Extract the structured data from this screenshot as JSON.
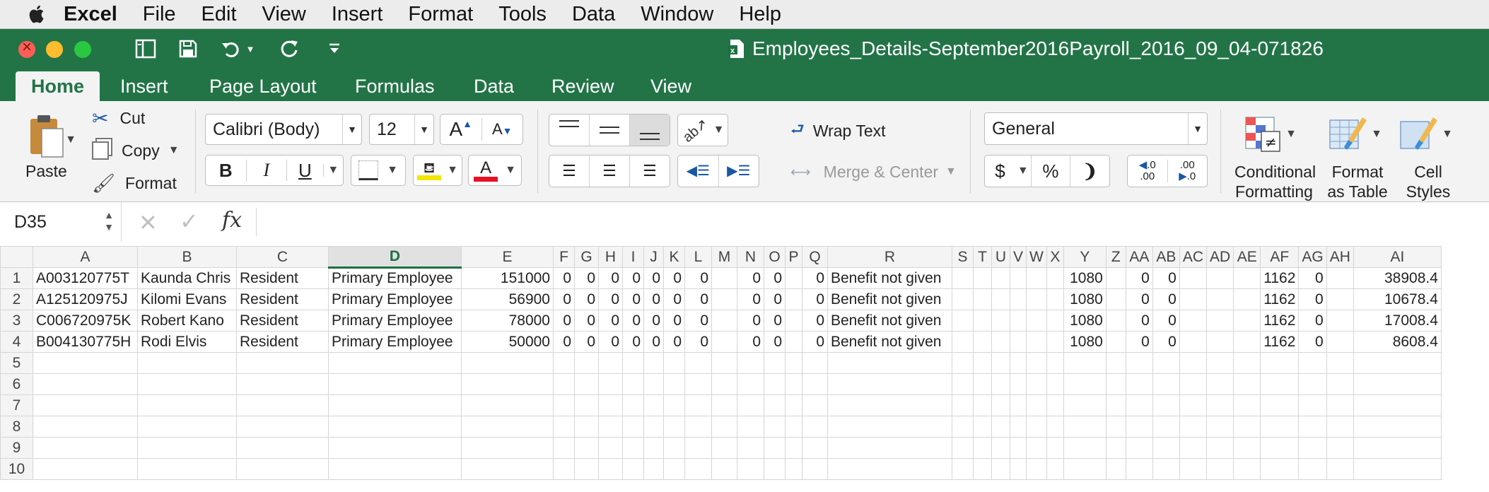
{
  "menubar": {
    "app": "Excel",
    "items": [
      "File",
      "Edit",
      "View",
      "Insert",
      "Format",
      "Tools",
      "Data",
      "Window",
      "Help"
    ]
  },
  "window": {
    "title": "Employees_Details-September2016Payroll_2016_09_04-071826"
  },
  "ribbon_tabs": [
    "Home",
    "Insert",
    "Page Layout",
    "Formulas",
    "Data",
    "Review",
    "View"
  ],
  "ribbon": {
    "paste": "Paste",
    "cut": "Cut",
    "copy": "Copy",
    "format_painter": "Format",
    "font_name": "Calibri (Body)",
    "font_size": "12",
    "wrap_text": "Wrap Text",
    "merge_center": "Merge & Center",
    "number_format": "General",
    "conditional_formatting": [
      "Conditional",
      "Formatting"
    ],
    "format_as_table": [
      "Format",
      "as Table"
    ],
    "cell_styles": [
      "Cell",
      "Styles"
    ]
  },
  "formula_bar": {
    "name_box": "D35",
    "fx": "fx",
    "content": ""
  },
  "sheet": {
    "selected_column": "D",
    "columns": [
      "A",
      "B",
      "C",
      "D",
      "E",
      "F",
      "G",
      "H",
      "I",
      "J",
      "K",
      "L",
      "M",
      "N",
      "O",
      "P",
      "Q",
      "R",
      "S",
      "T",
      "U",
      "V",
      "W",
      "X",
      "Y",
      "Z",
      "AA",
      "AB",
      "AC",
      "AD",
      "AE",
      "AF",
      "AG",
      "AH",
      "AI"
    ],
    "row_numbers": [
      "1",
      "2",
      "3",
      "4",
      "5",
      "6",
      "7",
      "8",
      "9",
      "10"
    ],
    "rows": [
      {
        "A": "A003120775T",
        "B": "Kaunda Chris",
        "C": "Resident",
        "D": "Primary Employee",
        "E": "151000",
        "F": "0",
        "G": "0",
        "H": "0",
        "I": "0",
        "J": "0",
        "K": "0",
        "L": "0",
        "N": "0",
        "O": "0",
        "Q": "0",
        "R": "Benefit not given",
        "Y": "1080",
        "AA": "0",
        "AB": "0",
        "AF": "1162",
        "AG": "0",
        "AI": "38908.4"
      },
      {
        "A": "A125120975J",
        "B": "Kilomi Evans",
        "C": "Resident",
        "D": "Primary Employee",
        "E": "56900",
        "F": "0",
        "G": "0",
        "H": "0",
        "I": "0",
        "J": "0",
        "K": "0",
        "L": "0",
        "N": "0",
        "O": "0",
        "Q": "0",
        "R": "Benefit not given",
        "Y": "1080",
        "AA": "0",
        "AB": "0",
        "AF": "1162",
        "AG": "0",
        "AI": "10678.4"
      },
      {
        "A": "C006720975K",
        "B": "Robert Kano",
        "C": "Resident",
        "D": "Primary Employee",
        "E": "78000",
        "F": "0",
        "G": "0",
        "H": "0",
        "I": "0",
        "J": "0",
        "K": "0",
        "L": "0",
        "N": "0",
        "O": "0",
        "Q": "0",
        "R": "Benefit not given",
        "Y": "1080",
        "AA": "0",
        "AB": "0",
        "AF": "1162",
        "AG": "0",
        "AI": "17008.4"
      },
      {
        "A": "B004130775H",
        "B": "Rodi Elvis",
        "C": "Resident",
        "D": "Primary Employee",
        "E": "50000",
        "F": "0",
        "G": "0",
        "H": "0",
        "I": "0",
        "J": "0",
        "K": "0",
        "L": "0",
        "N": "0",
        "O": "0",
        "Q": "0",
        "R": "Benefit not given",
        "Y": "1080",
        "AA": "0",
        "AB": "0",
        "AF": "1162",
        "AG": "0",
        "AI": "8608.4"
      }
    ]
  },
  "colors": {
    "excel_green": "#227447",
    "ribbon_bg": "#f3f3f3",
    "selected_header": "#1d6f42",
    "font_color_bar": "#e81123",
    "fill_color_bar": "#f2e600"
  }
}
